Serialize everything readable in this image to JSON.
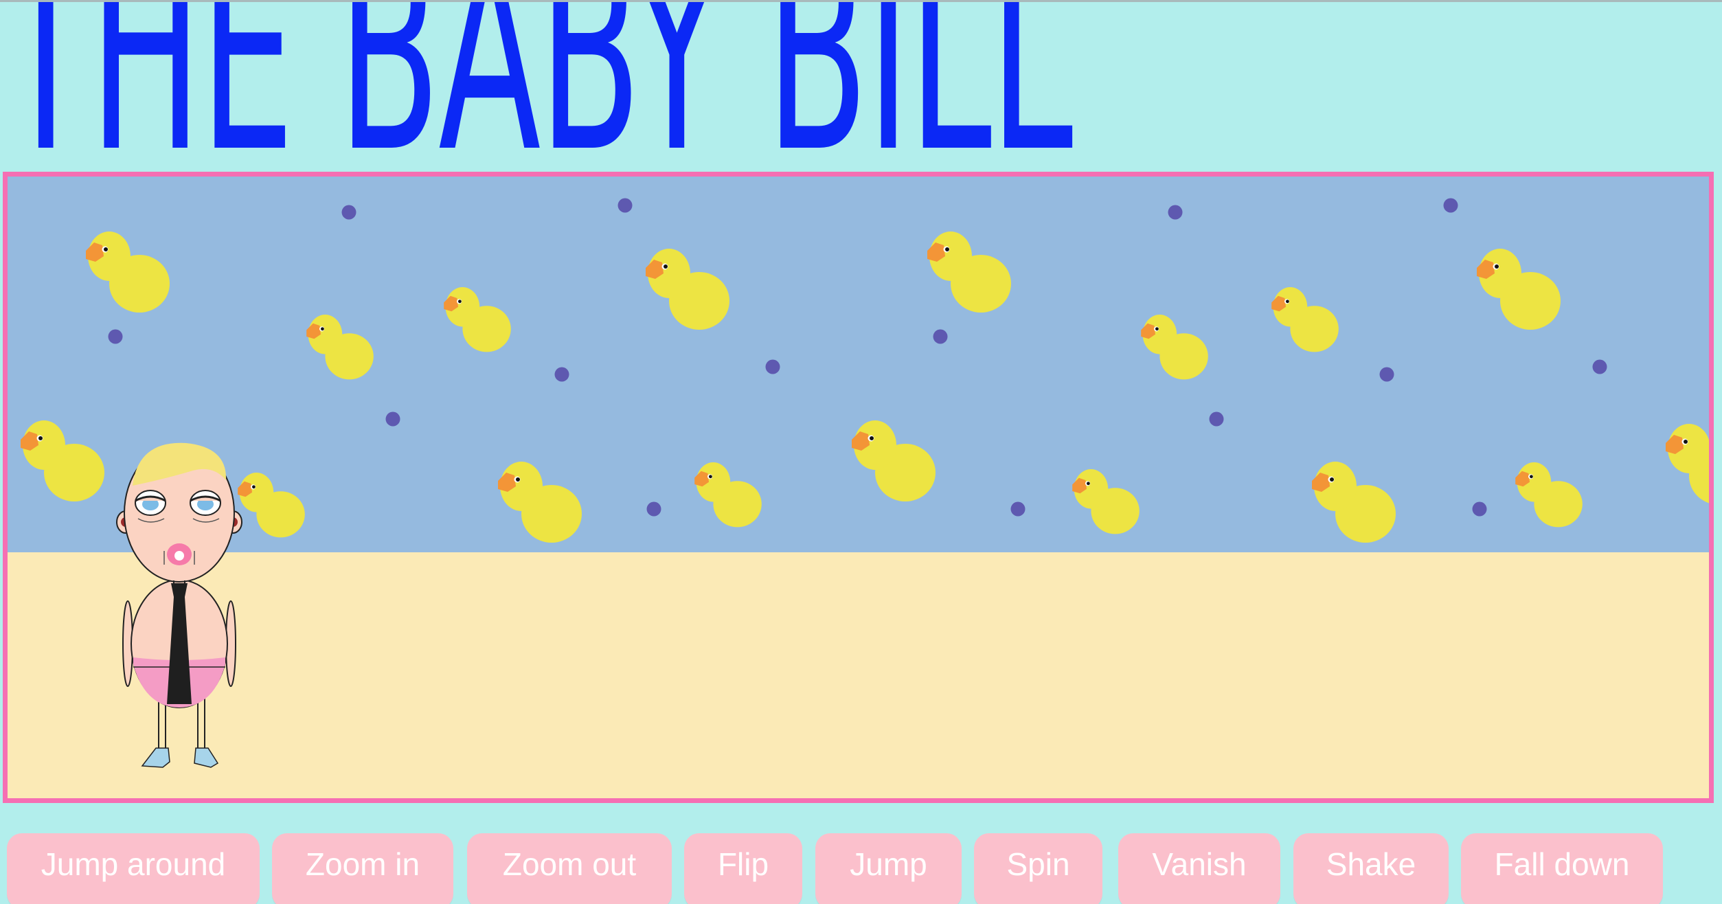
{
  "header": {
    "title": "THE BABY BILL"
  },
  "stage": {
    "sky_color": "#95badf",
    "floor_color": "#fbeab6",
    "border_color": "#f56fb3",
    "decor": [
      "rubber-duck-icon",
      "dot"
    ]
  },
  "character": {
    "name_icon": "baby-character-icon"
  },
  "controls": {
    "buttons": [
      {
        "label": "Jump around"
      },
      {
        "label": "Zoom in"
      },
      {
        "label": "Zoom out"
      },
      {
        "label": "Flip"
      },
      {
        "label": "Jump"
      },
      {
        "label": "Spin"
      },
      {
        "label": "Vanish"
      },
      {
        "label": "Shake"
      },
      {
        "label": "Fall down"
      }
    ]
  },
  "colors": {
    "background": "#b2eeec",
    "title": "#0b28f5",
    "button_bg": "#fbc0cc",
    "button_text": "#ffffff",
    "duck_body": "#ede443",
    "duck_beak": "#f39537",
    "dot": "#5e59b0"
  }
}
